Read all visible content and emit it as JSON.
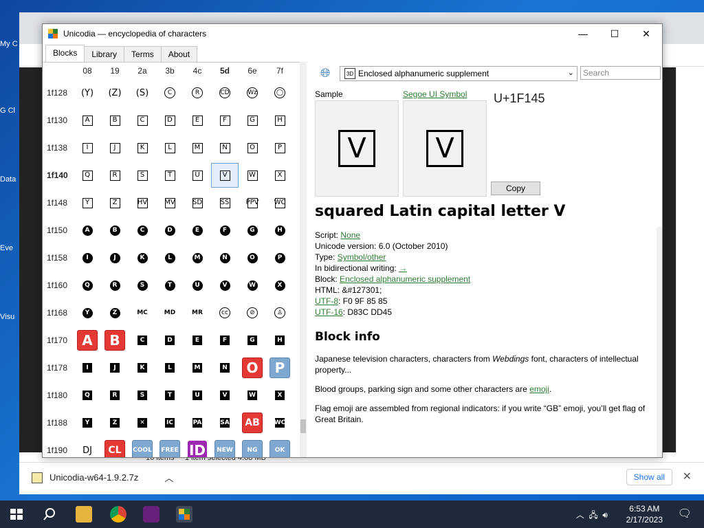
{
  "window": {
    "title": "Unicodia — encyclopedia of characters",
    "minimize": "—",
    "maximize": "☐",
    "close": "✕"
  },
  "tabs": [
    "Blocks",
    "Library",
    "Terms",
    "About"
  ],
  "grid": {
    "columns": [
      "08",
      "19",
      "2a",
      "3b",
      "4c",
      "5d",
      "6e",
      "7f"
    ],
    "selected_column": "5d",
    "rows": [
      {
        "label": "1f128",
        "cells": [
          [
            "par",
            "(Y)"
          ],
          [
            "par",
            "(Z)"
          ],
          [
            "par",
            "(S)"
          ],
          [
            "ci",
            "C"
          ],
          [
            "ci",
            "R"
          ],
          [
            "ci",
            "CD"
          ],
          [
            "ci",
            "Wz"
          ],
          [
            "ci",
            "◯"
          ]
        ]
      },
      {
        "label": "1f130",
        "cells": [
          [
            "sq",
            "A"
          ],
          [
            "sq",
            "B"
          ],
          [
            "sq",
            "C"
          ],
          [
            "sq",
            "D"
          ],
          [
            "sq",
            "E"
          ],
          [
            "sq",
            "F"
          ],
          [
            "sq",
            "G"
          ],
          [
            "sq",
            "H"
          ]
        ]
      },
      {
        "label": "1f138",
        "cells": [
          [
            "sq",
            "I"
          ],
          [
            "sq",
            "J"
          ],
          [
            "sq",
            "K"
          ],
          [
            "sq",
            "L"
          ],
          [
            "sq",
            "M"
          ],
          [
            "sq",
            "N"
          ],
          [
            "sq",
            "O"
          ],
          [
            "sq",
            "P"
          ]
        ]
      },
      {
        "label": "1f140",
        "cells": [
          [
            "sq",
            "Q"
          ],
          [
            "sq",
            "R"
          ],
          [
            "sq",
            "S"
          ],
          [
            "sq",
            "T"
          ],
          [
            "sq",
            "U"
          ],
          [
            "sq",
            "V"
          ],
          [
            "sq",
            "W"
          ],
          [
            "sq",
            "X"
          ]
        ]
      },
      {
        "label": "1f148",
        "cells": [
          [
            "sq",
            "Y"
          ],
          [
            "sq",
            "Z"
          ],
          [
            "sq",
            "HV"
          ],
          [
            "sq",
            "MV"
          ],
          [
            "sq",
            "SD"
          ],
          [
            "sq",
            "SS"
          ],
          [
            "sq",
            "PPV"
          ],
          [
            "sq",
            "WC"
          ]
        ]
      },
      {
        "label": "1f150",
        "cells": [
          [
            "bc",
            "A"
          ],
          [
            "bc",
            "B"
          ],
          [
            "bc",
            "C"
          ],
          [
            "bc",
            "D"
          ],
          [
            "bc",
            "E"
          ],
          [
            "bc",
            "F"
          ],
          [
            "bc",
            "G"
          ],
          [
            "bc",
            "H"
          ]
        ]
      },
      {
        "label": "1f158",
        "cells": [
          [
            "bc",
            "I"
          ],
          [
            "bc",
            "J"
          ],
          [
            "bc",
            "K"
          ],
          [
            "bc",
            "L"
          ],
          [
            "bc",
            "M"
          ],
          [
            "bc",
            "N"
          ],
          [
            "bc",
            "O"
          ],
          [
            "bc",
            "P"
          ]
        ]
      },
      {
        "label": "1f160",
        "cells": [
          [
            "bc",
            "Q"
          ],
          [
            "bc",
            "R"
          ],
          [
            "bc",
            "S"
          ],
          [
            "bc",
            "T"
          ],
          [
            "bc",
            "U"
          ],
          [
            "bc",
            "V"
          ],
          [
            "bc",
            "W"
          ],
          [
            "bc",
            "X"
          ]
        ]
      },
      {
        "label": "1f168",
        "cells": [
          [
            "bc",
            "Y"
          ],
          [
            "bc",
            "Z"
          ],
          [
            "txt",
            "MC"
          ],
          [
            "txt",
            "MD"
          ],
          [
            "txt",
            "MR"
          ],
          [
            "ci",
            "cc"
          ],
          [
            "ci",
            "⊘"
          ],
          [
            "ci",
            "♙"
          ]
        ]
      },
      {
        "label": "1f170",
        "cells": [
          [
            "red",
            "A"
          ],
          [
            "red",
            "B"
          ],
          [
            "bs",
            "C"
          ],
          [
            "bs",
            "D"
          ],
          [
            "bs",
            "E"
          ],
          [
            "bs",
            "F"
          ],
          [
            "bs",
            "G"
          ],
          [
            "bs",
            "H"
          ]
        ]
      },
      {
        "label": "1f178",
        "cells": [
          [
            "bs",
            "I"
          ],
          [
            "bs",
            "J"
          ],
          [
            "bs",
            "K"
          ],
          [
            "bs",
            "L"
          ],
          [
            "bs",
            "M"
          ],
          [
            "bs",
            "N"
          ],
          [
            "red",
            "O"
          ],
          [
            "blu",
            "P"
          ]
        ]
      },
      {
        "label": "1f180",
        "cells": [
          [
            "bs",
            "Q"
          ],
          [
            "bs",
            "R"
          ],
          [
            "bs",
            "S"
          ],
          [
            "bs",
            "T"
          ],
          [
            "bs",
            "U"
          ],
          [
            "bs",
            "V"
          ],
          [
            "bs",
            "W"
          ],
          [
            "bs",
            "X"
          ]
        ]
      },
      {
        "label": "1f188",
        "cells": [
          [
            "bs",
            "Y"
          ],
          [
            "bs",
            "Z"
          ],
          [
            "bs",
            "✕"
          ],
          [
            "bs",
            "IC"
          ],
          [
            "bs",
            "PA"
          ],
          [
            "bs",
            "SA"
          ],
          [
            "redsm",
            "AB"
          ],
          [
            "bs",
            "WC"
          ]
        ]
      },
      {
        "label": "1f190",
        "cells": [
          [
            "par",
            "DJ"
          ],
          [
            "redsm",
            "CL"
          ],
          [
            "blusm",
            "COOL"
          ],
          [
            "blusm",
            "FREE"
          ],
          [
            "pur",
            "ID"
          ],
          [
            "blusm",
            "NEW"
          ],
          [
            "blusm",
            "NG"
          ],
          [
            "blusm",
            "OK"
          ]
        ]
      }
    ],
    "selected_row": "1f140"
  },
  "toolbar": {
    "block_select": "Enclosed alphanumeric supplement",
    "search_placeholder": "Search"
  },
  "sample": {
    "sample_label": "Sample",
    "font_label": "Segoe UI Symbol",
    "codepoint": "U+1F145",
    "glyph": "V",
    "copy_label": "Copy"
  },
  "char_info": {
    "name": "squared Latin capital letter V",
    "script_label": "Script:",
    "script_value": "None",
    "version": "Unicode version: 6.0 (October 2010)",
    "type_label": "Type:",
    "type_value": "Symbol/other",
    "bidi_label": "In bidirectional writing:",
    "bidi_value": "→",
    "block_label": "Block:",
    "block_value": "Enclosed alphanumeric supplement",
    "html": "HTML: &#127301;",
    "utf8_label": "UTF-8",
    "utf8_value": ": F0 9F 85 85",
    "utf16_label": "UTF-16",
    "utf16_value": ": D83C DD45"
  },
  "block_info": {
    "heading": "Block info",
    "p1_before": "Japanese television characters, characters from ",
    "p1_italic": "Webdings",
    "p1_after": " font, characters of intellectual property...",
    "p2_before": "Blood groups, parking sign and some other characters are ",
    "p2_link": "emoji",
    "p2_after": ".",
    "p3": "Flag emoji are assembled from regional indicators: if you write “GB” emoji, you’ll get flag of Great Britain."
  },
  "background": {
    "explorer_items": "16 items",
    "explorer_selected": "1 item selected  4.88 MB",
    "download_file": "Unicodia-w64-1.9.2.7z",
    "show_all": "Show all",
    "desktop_labels": [
      "My C",
      "G\nCl",
      "Data",
      "Eve",
      "Visu"
    ]
  },
  "taskbar": {
    "time": "6:53 AM",
    "date": "2/17/2023"
  },
  "colors": {
    "link": "#2e7d32",
    "selection": "#e3eef9",
    "taskbar": "#1e2a3a"
  }
}
